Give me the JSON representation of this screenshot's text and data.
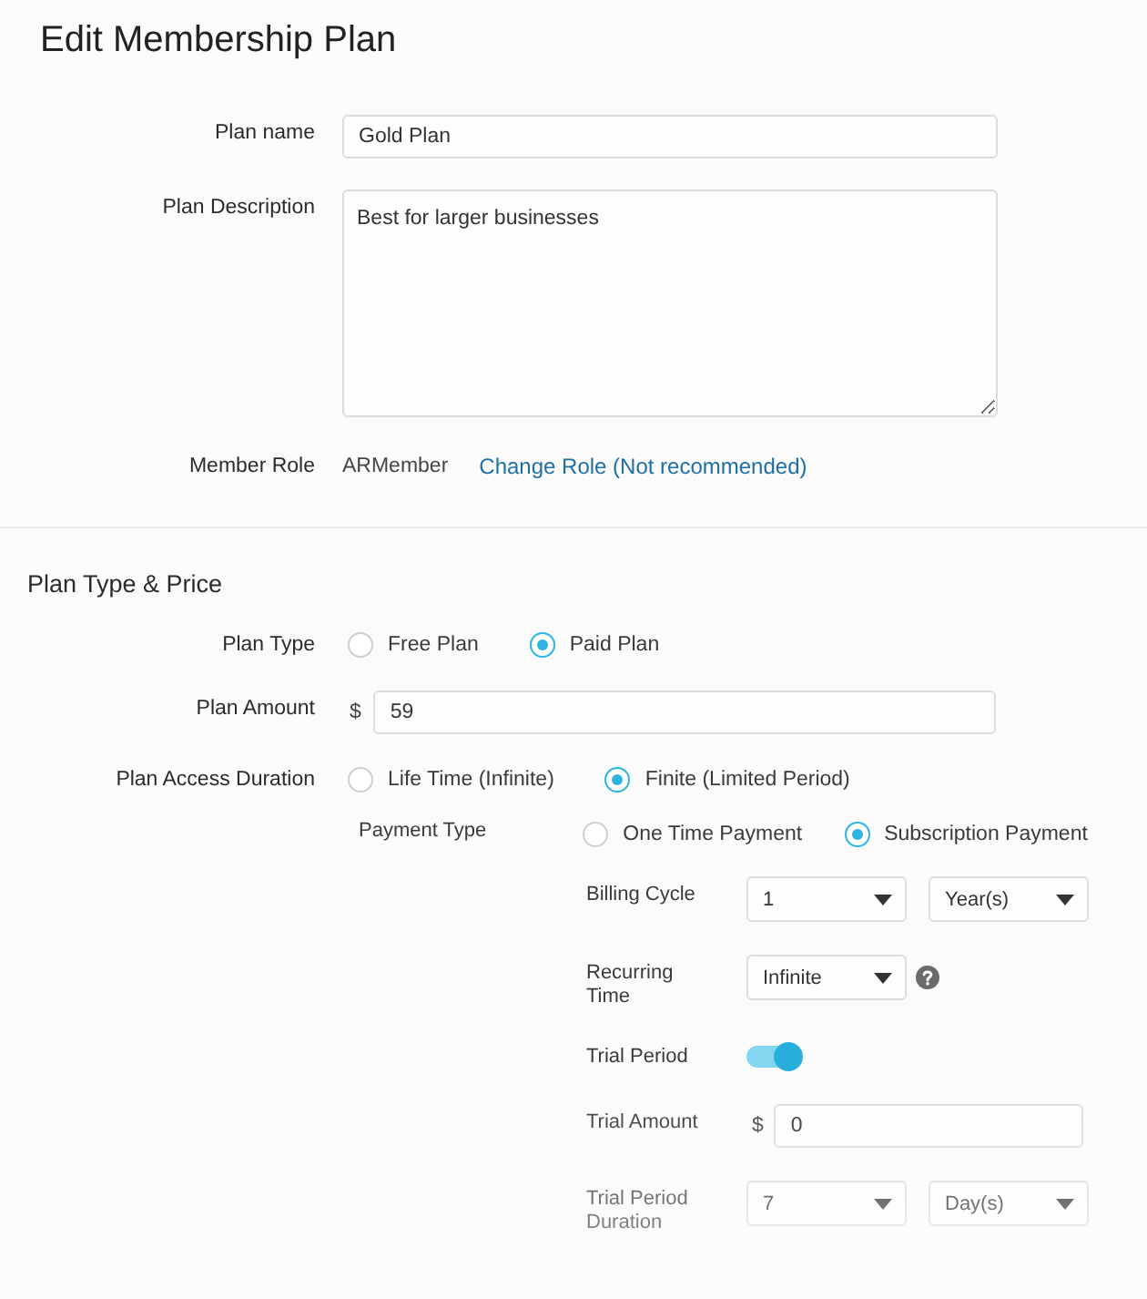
{
  "page": {
    "title": "Edit Membership Plan"
  },
  "general": {
    "fields": [
      {
        "kind": "text",
        "label": "Plan name",
        "value": "Gold Plan"
      },
      {
        "kind": "textarea",
        "label": "Plan Description",
        "value": "Best for larger businesses"
      },
      {
        "kind": "role",
        "label": "Member Role",
        "value": "ARMember",
        "link": "Change Role (Not recommended)"
      }
    ]
  },
  "plan_type_price": {
    "heading": "Plan Type & Price",
    "fields": [
      {
        "kind": "radio",
        "label": "Plan Type",
        "options": [
          {
            "label": "Free Plan",
            "selected": false
          },
          {
            "label": "Paid Plan",
            "selected": true
          }
        ]
      },
      {
        "kind": "amount",
        "label": "Plan Amount",
        "currency": "$",
        "value": "59"
      },
      {
        "kind": "radio",
        "label": "Plan Access Duration",
        "options": [
          {
            "label": "Life Time (Infinite)",
            "selected": false
          },
          {
            "label": "Finite (Limited Period)",
            "selected": true
          }
        ]
      }
    ],
    "payment_type": {
      "label": "Payment Type",
      "options": [
        {
          "label": "One Time Payment",
          "selected": false
        },
        {
          "label": "Subscription Payment",
          "selected": true
        }
      ]
    },
    "subscription": [
      {
        "kind": "select",
        "label": "Billing Cycle",
        "selects": [
          "1",
          "Year(s)"
        ]
      },
      {
        "kind": "select_help",
        "label": "Recurring Time",
        "selects": [
          "Infinite"
        ]
      },
      {
        "kind": "toggle",
        "label": "Trial Period",
        "on": true
      },
      {
        "kind": "amount",
        "label": "Trial Amount",
        "currency": "$",
        "value": "0"
      },
      {
        "kind": "select",
        "label": "Trial Period Duration",
        "selects": [
          "7",
          "Day(s)"
        ]
      }
    ]
  }
}
